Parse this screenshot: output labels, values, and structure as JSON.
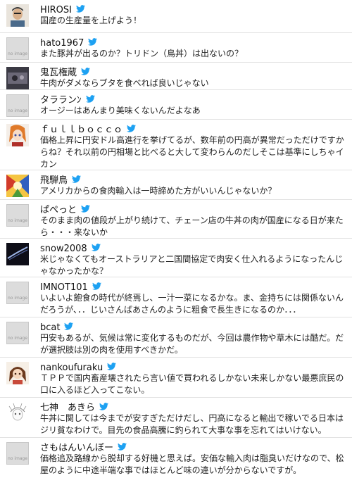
{
  "colors": {
    "bird": "#1da1f2",
    "divider": "#e2e2e2",
    "noimage_bg": "#dcdcdc"
  },
  "noimage_label": "no image",
  "tweets": [
    {
      "name": "HIROSI",
      "text": "国産の生産量を上げよう！",
      "avatar": "face-photo"
    },
    {
      "name": "hato1967",
      "text": "また豚丼が出るのか？トリドン（鳥丼）は出ないの？",
      "avatar": "no-image"
    },
    {
      "name": "鬼瓦権蔵",
      "text": "牛肉がダメならブタを食べれば良いじゃない",
      "avatar": "dark-photo"
    },
    {
      "name": "タラランﾝ",
      "text": "オージーはあんまり美味くないんだよなあ",
      "avatar": "no-image"
    },
    {
      "name": "ｆｕｌｌｂｏｃｃｏ",
      "text": "価格上昇に円安ドル高進行を挙げてるが、数年前の円高が異常だっただけですからね？それ以前の円相場と比べると大して変わらんのだしそこは基準にしちゃイカン",
      "avatar": "anime-girl"
    },
    {
      "name": "飛騨鳥",
      "text": "アメリカからの食肉輸入は一時諦めた方がいいんじゃないか？",
      "avatar": "colorful-art"
    },
    {
      "name": "ぱぺっと",
      "text": "そのまま肉の値段が上がり続けて、チェーン店の牛丼の肉が国産になる日が来たら・・・来ないか",
      "avatar": "no-image"
    },
    {
      "name": "snow2008",
      "text": "米じゃなくてもオーストラリアと二国間協定で肉安く仕入れるようになったんじゃなかったかな？",
      "avatar": "dark-streak"
    },
    {
      "name": "IMNOT101",
      "text": "いよいよ飽食の時代が終焉し、一汁一菜になるかな。ま、金持ちには関係ないんだろうが、．．じいさんばあさんのように粗食で長生きになるのか．．．",
      "avatar": "no-image"
    },
    {
      "name": "bcat",
      "text": "円安もあるが、気候は常に変化するものだが、今回は農作物や草木には酷だ。だが選択肢は別の肉を使用すべきかだ。",
      "avatar": "no-image"
    },
    {
      "name": "nankoufuraku",
      "text": "ＴＰＰで国内畜産壊されたら言い値で買われるしかない未来しかない最悪庶民の口に入るほど入ってこない。",
      "avatar": "anime-brown"
    },
    {
      "name": "七神　あきら",
      "text": "牛丼に関しては今までが安すぎただけだし、円高になると輸出で稼いでる日本はジリ貧なわけで。目先の食品高騰に釣られて大事な事を忘れてはいけない。",
      "avatar": "sketch-face"
    },
    {
      "name": "さもはんいんぼー",
      "text": "価格追及路線から脱却する好機と思えば。安価な輸入肉は脂臭いだけなので、松屋のように中途半端な事ではほとんど味の違いが分からないですが。",
      "avatar": "no-image"
    }
  ]
}
